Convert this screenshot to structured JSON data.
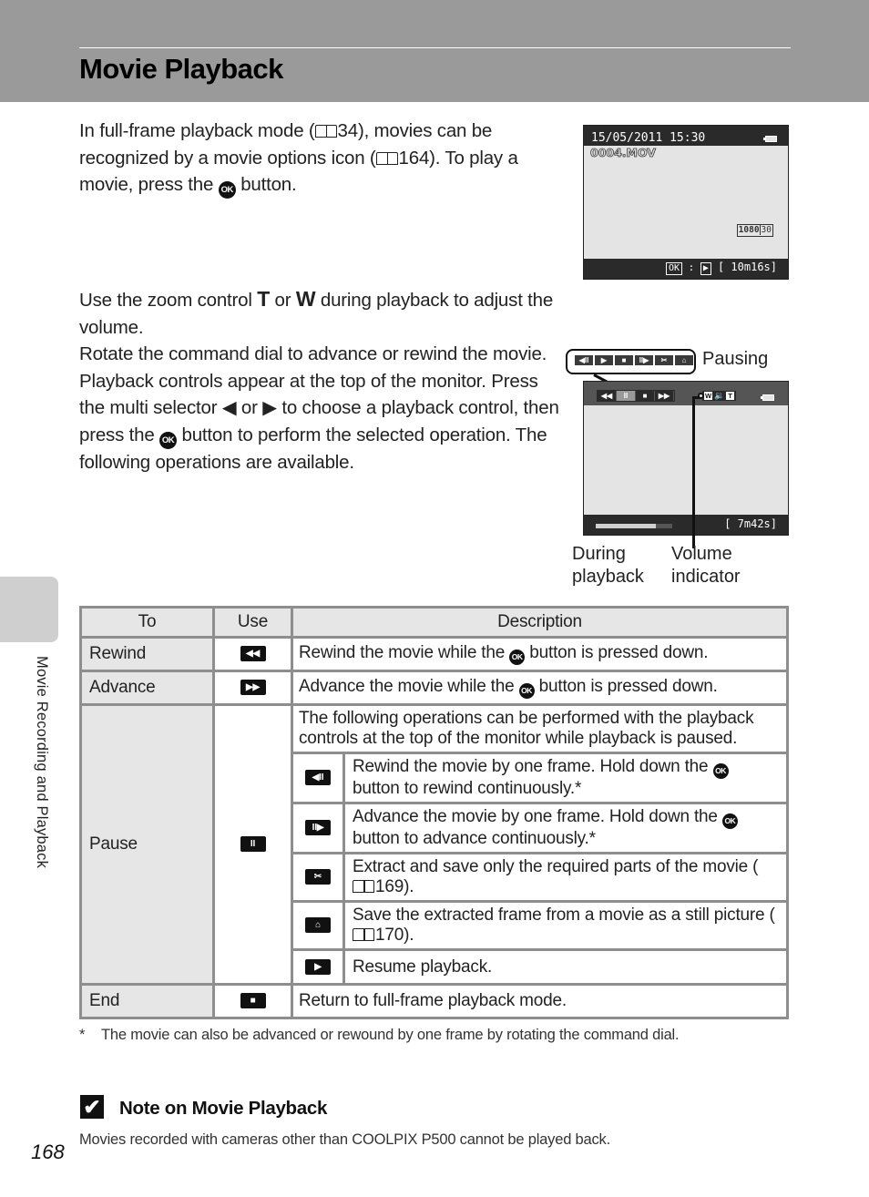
{
  "header": {
    "title": "Movie Playback"
  },
  "intro": {
    "p1_a": "In full-frame playback mode (",
    "p1_ref1": "34",
    "p1_b": "), movies can be recognized by a movie options icon (",
    "p1_ref2": "164",
    "p1_c": "). To play a movie, press the ",
    "p1_d": " button.",
    "p2_a": "Use the zoom control ",
    "p2_t": "T",
    "p2_or": " or ",
    "p2_w": "W",
    "p2_b": " during playback to adjust the volume.",
    "p3_a": "Rotate the command dial to advance or rewind the movie. Playback controls appear at the top of the monitor. Press the multi selector ",
    "p3_left": "◀",
    "p3_or": " or ",
    "p3_right": "▶",
    "p3_b": " to choose a playback control, then press the ",
    "p3_c": " button to perform the selected operation. The following operations are available."
  },
  "ok_label": "OK",
  "screen_fullframe": {
    "date_time": "15/05/2011  15:30",
    "file_name": "0004.MOV",
    "movie_option": "1080",
    "movie_option_fps": "30",
    "ok_hint": "OK",
    "play_glyph": "▶",
    "remaining": "[  10m16s]"
  },
  "screen_playback": {
    "pausing_label": "Pausing",
    "pause_controls": [
      "◀II",
      "▶",
      "■",
      "II▶",
      "✂",
      "⌂"
    ],
    "playback_controls": [
      "◀◀",
      "II",
      "■",
      "▶▶"
    ],
    "active_control_index": 1,
    "volume_w": "W",
    "volume_speaker": "🔉",
    "volume_t": "T",
    "remaining": "[   7m42s]",
    "progress_fraction": 0.78,
    "caption_during": [
      "During",
      "playback"
    ],
    "caption_volume": [
      "Volume",
      "indicator"
    ]
  },
  "table": {
    "headers": [
      "To",
      "Use",
      "Description"
    ],
    "rewind": {
      "to": "Rewind",
      "icon": "◀◀",
      "desc_a": "Rewind the movie while the ",
      "desc_b": " button is pressed down."
    },
    "advance": {
      "to": "Advance",
      "icon": "▶▶",
      "desc_a": "Advance the movie while the ",
      "desc_b": " button is pressed down."
    },
    "pause": {
      "to": "Pause",
      "icon": "II",
      "intro": "The following operations can be performed with the playback controls at the top of the monitor while playback is paused.",
      "subs": [
        {
          "icon": "◀II",
          "desc_a": "Rewind the movie by one frame. Hold down the ",
          "desc_b": " button to rewind continuously.*"
        },
        {
          "icon": "II▶",
          "desc_a": "Advance the movie by one frame. Hold down the ",
          "desc_b": " button to advance continuously.*"
        },
        {
          "icon": "✂",
          "desc_a": "Extract and save only the required parts of the movie (",
          "ref": "169",
          "desc_b": ")."
        },
        {
          "icon": "⌂",
          "desc_a": "Save the extracted frame from a movie as a still picture (",
          "ref": "170",
          "desc_b": ")."
        },
        {
          "icon": "▶",
          "desc_a": "Resume playback."
        }
      ]
    },
    "end": {
      "to": "End",
      "icon": "■",
      "desc": "Return to full-frame playback mode."
    }
  },
  "footnote": {
    "mark": "*",
    "text": "The movie can also be advanced or rewound by one frame by rotating the command dial."
  },
  "note": {
    "check": "✔",
    "title": "Note on Movie Playback",
    "body": "Movies recorded with cameras other than COOLPIX P500 cannot be played back."
  },
  "page_number": "168",
  "side_label": "Movie Recording and Playback"
}
